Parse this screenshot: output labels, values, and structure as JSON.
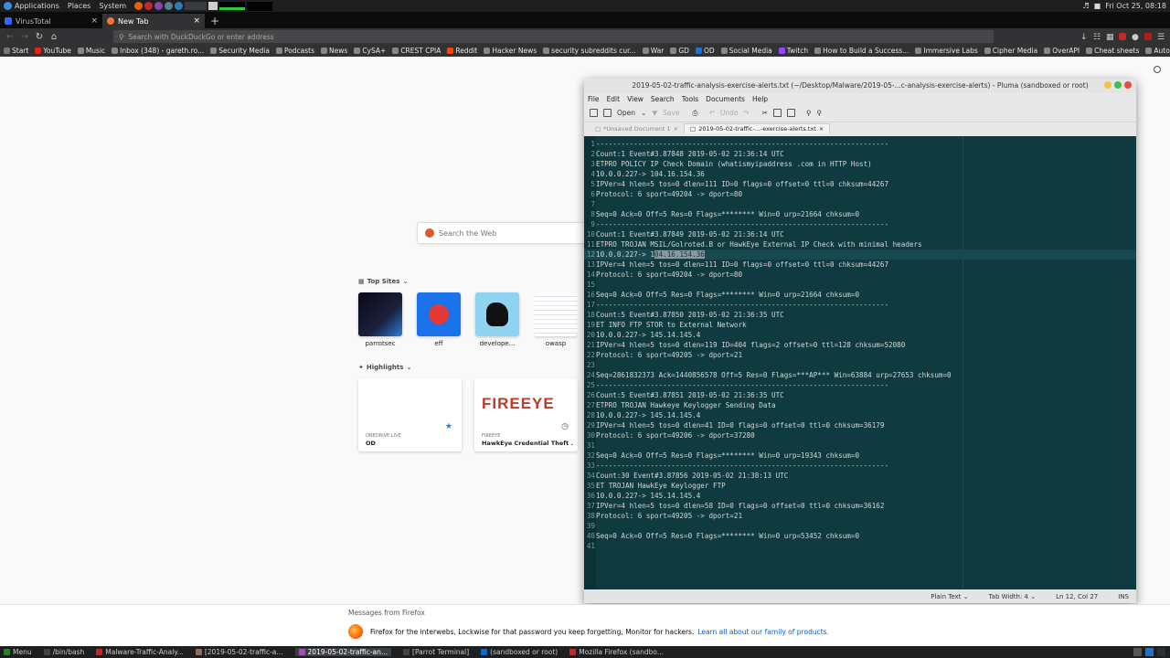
{
  "top_panel": {
    "menus": [
      "Applications",
      "Places",
      "System"
    ],
    "clock": "Fri Oct 25, 08:18"
  },
  "browser": {
    "tabs": [
      {
        "label": "VirusTotal",
        "active": false
      },
      {
        "label": "New Tab",
        "active": true
      }
    ],
    "url_placeholder": "Search with DuckDuckGo or enter address",
    "bookmarks": [
      "Start",
      "YouTube",
      "Music",
      "Inbox (348) - gareth.ro...",
      "Security Media",
      "Podcasts",
      "News",
      "CySA+",
      "CREST CPIA",
      "Reddit",
      "Hacker News",
      "security subreddits cur...",
      "War",
      "GD",
      "OD",
      "Social Media",
      "Twitch",
      "How to Build a Success...",
      "Immersive Labs",
      "Cipher Media",
      "OverAPI",
      "Cheat sheets",
      "Automatepdf"
    ]
  },
  "newtab": {
    "search_placeholder": "Search the Web",
    "top_sites_title": "Top Sites",
    "top_sites": [
      "parrotsec",
      "eff",
      "develope...",
      "owasp"
    ],
    "highlights_title": "Highlights",
    "highlights": [
      {
        "source": "ONEDRIVE LIVE",
        "title": "OD"
      },
      {
        "source": "FIREEYE",
        "title": "HawkEye Credential Theft ...",
        "logo": "FIREEYE"
      }
    ]
  },
  "messages": {
    "title": "Messages from Firefox",
    "text": "Firefox for the interwebs, Lockwise for that password you keep forgetting, Monitor for hackers.",
    "link": "Learn all about our family of products."
  },
  "pluma": {
    "title": "2019-05-02-traffic-analysis-exercise-alerts.txt (~/Desktop/Malware/2019-05-...c-analysis-exercise-alerts) - Pluma (sandboxed or root)",
    "menu": [
      "File",
      "Edit",
      "View",
      "Search",
      "Tools",
      "Documents",
      "Help"
    ],
    "toolbar": {
      "open": "Open",
      "save": "Save",
      "undo": "Undo"
    },
    "doc_tabs": [
      "*Unsaved Document 1",
      "2019-05-02-traffic-...-exercise-alerts.txt"
    ],
    "lines": [
      "----------------------------------------------------------------------",
      "Count:1 Event#3.87848 2019-05-02 21:36:14 UTC",
      "ETPRO POLICY IP Check Domain (whatismyipaddress .com in HTTP Host)",
      "10.0.0.227-> 104.16.154.36",
      "IPVer=4 hlen=5 tos=0 dlen=111 ID=0 flags=0 offset=0 ttl=0 chksum=44267",
      "Protocol: 6 sport=49204 -> dport=80",
      "",
      "Seq=0 Ack=0 Off=5 Res=0 Flags=******** Win=0 urp=21664 chksum=0",
      "----------------------------------------------------------------------",
      "Count:1 Event#3.87849 2019-05-02 21:36:14 UTC",
      "ETPRO TROJAN MSIL/Golroted.B or HawkEye External IP Check with minimal headers",
      "10.0.0.227-> 104.16.154.36",
      "IPVer=4 hlen=5 tos=0 dlen=111 ID=0 flags=0 offset=0 ttl=0 chksum=44267",
      "Protocol: 6 sport=49204 -> dport=80",
      "",
      "Seq=0 Ack=0 Off=5 Res=0 Flags=******** Win=0 urp=21664 chksum=0",
      "----------------------------------------------------------------------",
      "Count:5 Event#3.87850 2019-05-02 21:36:35 UTC",
      "ET INFO FTP STOR to External Network",
      "10.0.0.227-> 145.14.145.4",
      "IPVer=4 hlen=5 tos=0 dlen=119 ID=404 flags=2 offset=0 ttl=128 chksum=52080",
      "Protocol: 6 sport=49205 -> dport=21",
      "",
      "Seq=2861832373 Ack=1440856578 Off=5 Res=0 Flags=***AP*** Win=63884 urp=27653 chksum=0",
      "----------------------------------------------------------------------",
      "Count:5 Event#3.87851 2019-05-02 21:36:35 UTC",
      "ETPRO TROJAN Hawkeye Keylogger Sending Data",
      "10.0.0.227-> 145.14.145.4",
      "IPVer=4 hlen=5 tos=0 dlen=41 ID=0 flags=0 offset=0 ttl=0 chksum=36179",
      "Protocol: 6 sport=49206 -> dport=37280",
      "",
      "Seq=0 Ack=0 Off=5 Res=0 Flags=******** Win=0 urp=19343 chksum=0",
      "----------------------------------------------------------------------",
      "Count:30 Event#3.87856 2019-05-02 21:38:13 UTC",
      "ET TROJAN HawkEye Keylogger FTP",
      "10.0.0.227-> 145.14.145.4",
      "IPVer=4 hlen=5 tos=0 dlen=58 ID=0 flags=0 offset=0 ttl=0 chksum=36162",
      "Protocol: 6 sport=49205 -> dport=21",
      "",
      "Seq=0 Ack=0 Off=5 Res=0 Flags=******** Win=0 urp=53452 chksum=0",
      ""
    ],
    "current_line": 12,
    "selected_text": "04.16.154.36",
    "status": {
      "syntax": "Plain Text",
      "tab_width": "Tab Width: 4",
      "position": "Ln 12, Col 27",
      "mode": "INS"
    }
  },
  "taskbar": {
    "items": [
      {
        "label": "Menu",
        "active": false
      },
      {
        "label": "/bin/bash",
        "active": false
      },
      {
        "label": "Malware-Traffic-Analy...",
        "active": false
      },
      {
        "label": "[2019-05-02-traffic-a...",
        "active": false
      },
      {
        "label": "2019-05-02-traffic-an...",
        "active": true
      },
      {
        "label": "[Parrot Terminal]",
        "active": false
      },
      {
        "label": "(sandboxed or root)",
        "active": false
      },
      {
        "label": "Mozilla Firefox (sandbo...",
        "active": false
      }
    ]
  }
}
